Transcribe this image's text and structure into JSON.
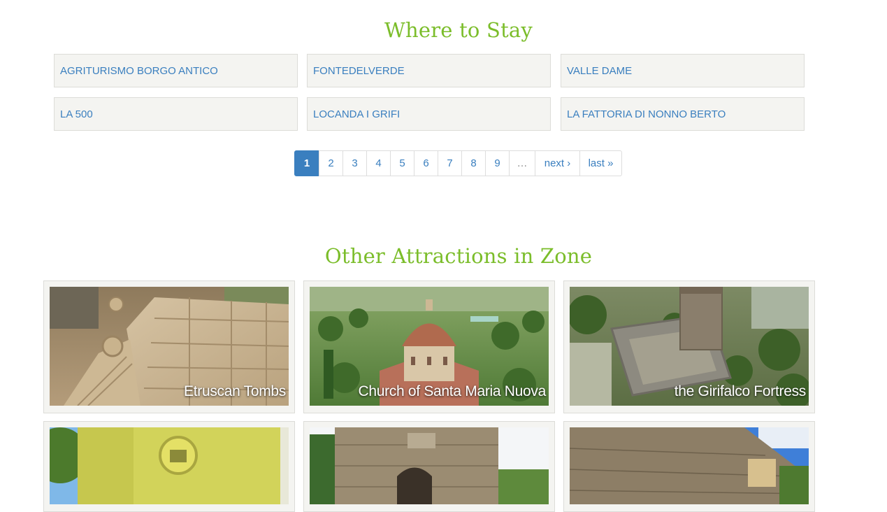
{
  "where_to_stay": {
    "title": "Where to Stay",
    "items": [
      "AGRITURISMO BORGO ANTICO",
      "FONTEDELVERDE",
      "VALLE DAME",
      "LA 500",
      "LOCANDA I GRIFI",
      "LA FATTORIA DI NONNO BERTO"
    ]
  },
  "pager": {
    "current": "1",
    "pages": [
      "2",
      "3",
      "4",
      "5",
      "6",
      "7",
      "8",
      "9"
    ],
    "ellipsis": "…",
    "next": "next ›",
    "last": "last »"
  },
  "attractions": {
    "title": "Other Attractions in Zone",
    "cards": [
      {
        "caption": "Etruscan Tombs"
      },
      {
        "caption": "Church of Santa Maria Nuova"
      },
      {
        "caption": "the Girifalco Fortress"
      },
      {
        "caption": ""
      },
      {
        "caption": ""
      },
      {
        "caption": ""
      }
    ]
  },
  "colors": {
    "title_green": "#7bbd2a",
    "link_blue": "#3a7fbf",
    "tile_bg": "#f4f4f1"
  }
}
